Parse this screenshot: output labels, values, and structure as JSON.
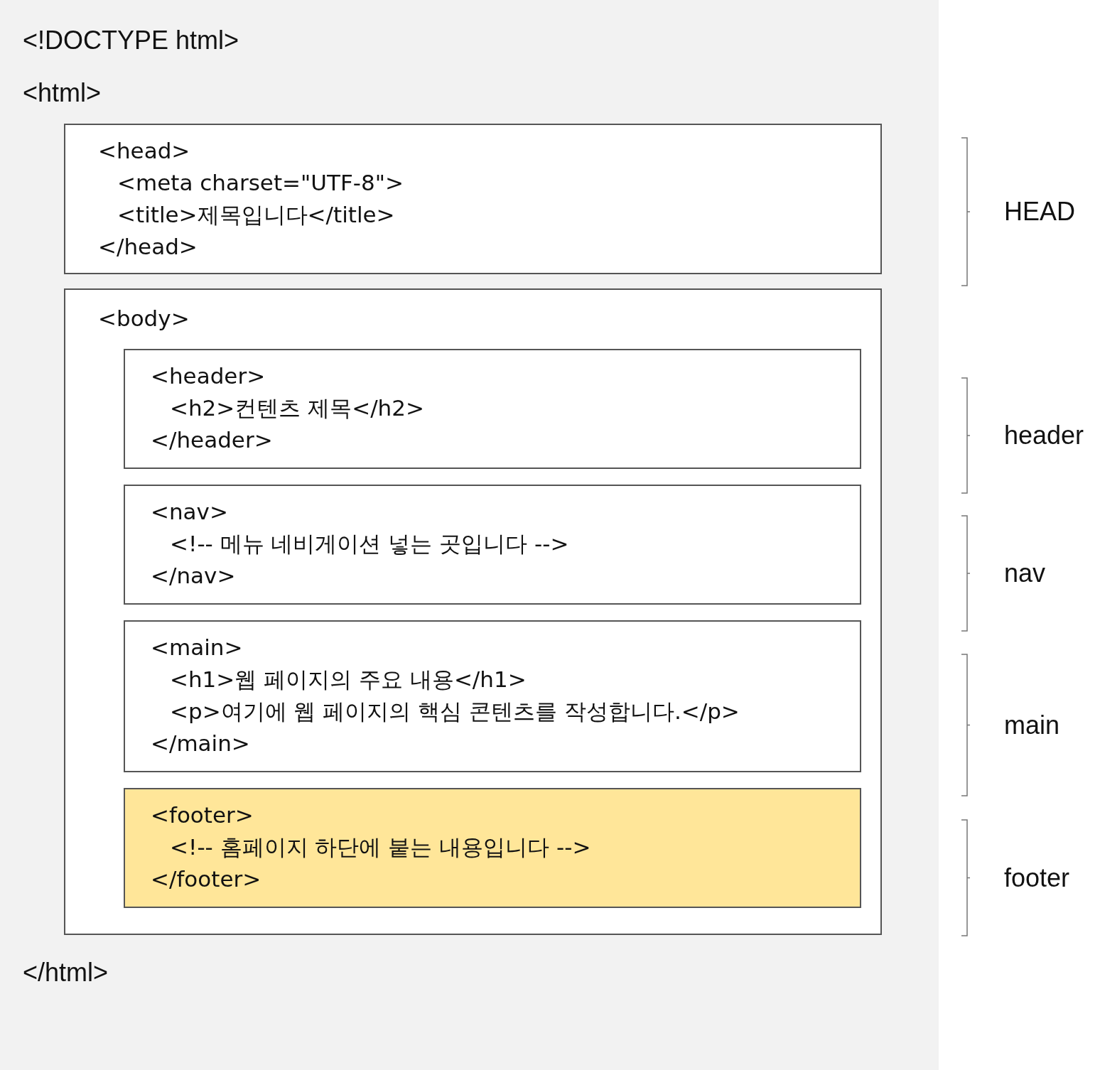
{
  "doctype": "<!DOCTYPE html>",
  "html_open": "<html>",
  "head": {
    "open": "<head>",
    "children": [
      "<meta charset=\"UTF-8\">",
      "<title>제목입니다</title>"
    ],
    "close": "</head>"
  },
  "body": {
    "open": "<body>",
    "sections": [
      {
        "open": "<header>",
        "children": [
          "<h2>컨텐츠 제목</h2>"
        ],
        "close": "</header>",
        "highlighted": false
      },
      {
        "open": "<nav>",
        "children": [
          "<!-- 메뉴 네비게이션 넣는 곳입니다 -->"
        ],
        "close": "</nav>",
        "highlighted": false
      },
      {
        "open": "<main>",
        "children": [
          "<h1>웹 페이지의 주요 내용</h1>",
          "<p>여기에 웹 페이지의 핵심 콘텐츠를 작성합니다.</p>"
        ],
        "close": "</main>",
        "highlighted": false
      },
      {
        "open": "<footer>",
        "children": [
          "<!-- 홈페이지 하단에 붙는 내용입니다 -->"
        ],
        "close": "</footer>",
        "highlighted": true
      }
    ]
  },
  "html_close": "</html>",
  "labels": [
    "HEAD",
    "header",
    "nav",
    "main",
    "footer"
  ]
}
